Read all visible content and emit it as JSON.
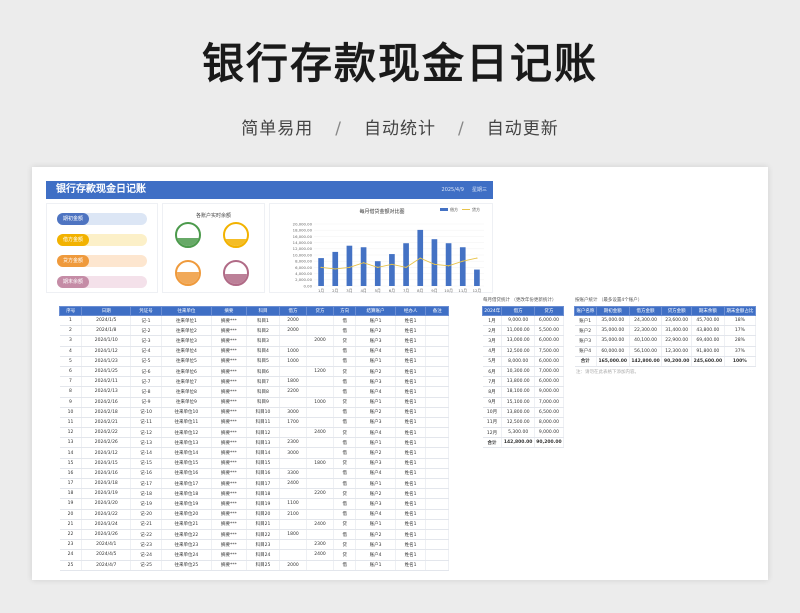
{
  "hero": {
    "title": "银行存款现金日记账",
    "subtitle": [
      "简单易用",
      "自动统计",
      "自动更新"
    ],
    "separator": "/"
  },
  "sheet": {
    "title": "银行存款现金日记账",
    "date": "2025/4/9",
    "weekday": "星期三"
  },
  "summary_pills": [
    {
      "label": "期初金额",
      "color": "#4e74c1",
      "track": "#dce6f5"
    },
    {
      "label": "借方金额",
      "color": "#f2b200",
      "track": "#fcf0c8"
    },
    {
      "label": "贷方金额",
      "color": "#ef9a3c",
      "track": "#fde6cf"
    },
    {
      "label": "期末余额",
      "color": "#c58ca6",
      "track": "#f4e1ea"
    }
  ],
  "gauges": {
    "title": "各账户实时余额",
    "items": [
      {
        "color": "#4c9a4c",
        "level": 0.35
      },
      {
        "color": "#f2b200",
        "level": 0.3
      },
      {
        "color": "#ef9a3c",
        "level": 0.55
      },
      {
        "color": "#b06a86",
        "level": 0.45
      }
    ]
  },
  "chart_data": {
    "type": "bar",
    "title": "每月借贷金额对比图",
    "legend": [
      "借方",
      "贷方"
    ],
    "legend_position": "top-right",
    "categories": [
      "1月",
      "2月",
      "3月",
      "4月",
      "5月",
      "6月",
      "7月",
      "8月",
      "9月",
      "10月",
      "11月",
      "12月"
    ],
    "y_ticks": [
      "20,000.00",
      "18,000.00",
      "16,000.00",
      "14,000.00",
      "12,000.00",
      "10,000.00",
      "8,000.00",
      "6,000.00",
      "4,000.00",
      "2,000.00",
      "0.00"
    ],
    "ylim": [
      0,
      20000
    ],
    "series": [
      {
        "name": "借方",
        "type": "bar",
        "color": "#4472c4",
        "values": [
          9000,
          11000,
          13000,
          12500,
          8000,
          10300,
          13800,
          18100,
          15100,
          13800,
          12500,
          5300
        ]
      },
      {
        "name": "贷方",
        "type": "line",
        "color": "#e8c34a",
        "values": [
          6000,
          5500,
          6000,
          7500,
          6000,
          7000,
          6000,
          9000,
          7000,
          6500,
          8000,
          9000
        ]
      }
    ]
  },
  "journal": {
    "headers": [
      "序号",
      "日期",
      "凭证号",
      "往来单位",
      "摘要",
      "科目",
      "借方",
      "贷方",
      "方向",
      "结算账户",
      "经办人",
      "备注"
    ],
    "rows": [
      [
        "1",
        "2024/1/5",
        "记-1",
        "往来单位1",
        "摘要***",
        "科目1",
        "2000",
        "",
        "借",
        "账户1",
        "姓名1",
        ""
      ],
      [
        "2",
        "2024/1/8",
        "记-2",
        "往来单位2",
        "摘要***",
        "科目2",
        "2000",
        "",
        "借",
        "账户2",
        "姓名1",
        ""
      ],
      [
        "3",
        "2024/1/10",
        "记-3",
        "往来单位3",
        "摘要***",
        "科目3",
        "",
        "2000",
        "贷",
        "账户3",
        "姓名1",
        ""
      ],
      [
        "4",
        "2024/1/12",
        "记-4",
        "往来单位4",
        "摘要***",
        "科目4",
        "1000",
        "",
        "借",
        "账户4",
        "姓名1",
        ""
      ],
      [
        "5",
        "2024/1/23",
        "记-5",
        "往来单位5",
        "摘要***",
        "科目5",
        "1000",
        "",
        "借",
        "账户1",
        "姓名1",
        ""
      ],
      [
        "6",
        "2024/1/25",
        "记-6",
        "往来单位6",
        "摘要***",
        "科目6",
        "",
        "1200",
        "贷",
        "账户2",
        "姓名1",
        ""
      ],
      [
        "7",
        "2024/2/11",
        "记-7",
        "往来单位7",
        "摘要***",
        "科目7",
        "1800",
        "",
        "借",
        "账户3",
        "姓名1",
        ""
      ],
      [
        "8",
        "2024/2/13",
        "记-8",
        "往来单位8",
        "摘要***",
        "科目8",
        "2200",
        "",
        "借",
        "账户4",
        "姓名1",
        ""
      ],
      [
        "9",
        "2024/2/16",
        "记-9",
        "往来单位9",
        "摘要***",
        "科目9",
        "",
        "1000",
        "贷",
        "账户1",
        "姓名1",
        ""
      ],
      [
        "10",
        "2024/2/18",
        "记-10",
        "往来单位10",
        "摘要***",
        "科目10",
        "3000",
        "",
        "借",
        "账户2",
        "姓名1",
        ""
      ],
      [
        "11",
        "2024/2/21",
        "记-11",
        "往来单位11",
        "摘要***",
        "科目11",
        "1700",
        "",
        "借",
        "账户3",
        "姓名1",
        ""
      ],
      [
        "12",
        "2024/2/22",
        "记-12",
        "往来单位12",
        "摘要***",
        "科目12",
        "",
        "2400",
        "贷",
        "账户4",
        "姓名1",
        ""
      ],
      [
        "13",
        "2024/2/26",
        "记-13",
        "往来单位13",
        "摘要***",
        "科目13",
        "2300",
        "",
        "借",
        "账户1",
        "姓名1",
        ""
      ],
      [
        "14",
        "2024/3/12",
        "记-14",
        "往来单位14",
        "摘要***",
        "科目14",
        "3000",
        "",
        "借",
        "账户2",
        "姓名1",
        ""
      ],
      [
        "15",
        "2024/3/15",
        "记-15",
        "往来单位15",
        "摘要***",
        "科目15",
        "",
        "1800",
        "贷",
        "账户3",
        "姓名1",
        ""
      ],
      [
        "16",
        "2024/3/16",
        "记-16",
        "往来单位16",
        "摘要***",
        "科目16",
        "3300",
        "",
        "借",
        "账户4",
        "姓名1",
        ""
      ],
      [
        "17",
        "2024/3/18",
        "记-17",
        "往来单位17",
        "摘要***",
        "科目17",
        "2400",
        "",
        "借",
        "账户1",
        "姓名1",
        ""
      ],
      [
        "18",
        "2024/3/19",
        "记-18",
        "往来单位18",
        "摘要***",
        "科目18",
        "",
        "2200",
        "贷",
        "账户2",
        "姓名1",
        ""
      ],
      [
        "19",
        "2024/3/20",
        "记-19",
        "往来单位19",
        "摘要***",
        "科目19",
        "1100",
        "",
        "借",
        "账户3",
        "姓名1",
        ""
      ],
      [
        "20",
        "2024/3/22",
        "记-20",
        "往来单位20",
        "摘要***",
        "科目20",
        "2100",
        "",
        "借",
        "账户4",
        "姓名1",
        ""
      ],
      [
        "21",
        "2024/3/24",
        "记-21",
        "往来单位21",
        "摘要***",
        "科目21",
        "",
        "2400",
        "贷",
        "账户1",
        "姓名1",
        ""
      ],
      [
        "22",
        "2024/3/26",
        "记-22",
        "往来单位22",
        "摘要***",
        "科目22",
        "1800",
        "",
        "借",
        "账户2",
        "姓名1",
        ""
      ],
      [
        "23",
        "2024/4/1",
        "记-23",
        "往来单位23",
        "摘要***",
        "科目23",
        "",
        "2300",
        "贷",
        "账户3",
        "姓名1",
        ""
      ],
      [
        "24",
        "2024/4/5",
        "记-24",
        "往来单位24",
        "摘要***",
        "科目24",
        "",
        "2400",
        "贷",
        "账户4",
        "姓名1",
        ""
      ],
      [
        "25",
        "2024/4/7",
        "记-25",
        "往来单位25",
        "摘要***",
        "科目25",
        "2000",
        "",
        "借",
        "账户1",
        "姓名1",
        ""
      ]
    ]
  },
  "monthly": {
    "caption": "每月借贷统计    （更改年份更新统计）",
    "headers": [
      "2024年",
      "借方",
      "贷方"
    ],
    "rows": [
      [
        "1月",
        "9,000.00",
        "6,000.00"
      ],
      [
        "2月",
        "11,000.00",
        "5,500.00"
      ],
      [
        "3月",
        "13,000.00",
        "6,000.00"
      ],
      [
        "4月",
        "12,500.00",
        "7,500.00"
      ],
      [
        "5月",
        "8,000.00",
        "6,000.00"
      ],
      [
        "6月",
        "10,300.00",
        "7,000.00"
      ],
      [
        "7月",
        "13,800.00",
        "6,000.00"
      ],
      [
        "8月",
        "18,100.00",
        "9,000.00"
      ],
      [
        "9月",
        "15,100.00",
        "7,000.00"
      ],
      [
        "10月",
        "13,800.00",
        "6,500.00"
      ],
      [
        "11月",
        "12,500.00",
        "8,000.00"
      ],
      [
        "12月",
        "5,300.00",
        "9,000.00"
      ]
    ],
    "total": [
      "合计",
      "142,800.00",
      "90,200.00"
    ]
  },
  "accounts": {
    "caption": "按账户统计  （最多设置4个账户）",
    "headers": [
      "账户名称",
      "期初金额",
      "借方金额",
      "贷方金额",
      "期末余额",
      "期末金额占比"
    ],
    "rows": [
      [
        "账户1",
        "35,000.00",
        "24,300.00",
        "23,600.00",
        "45,700.00",
        "18%"
      ],
      [
        "账户2",
        "35,000.00",
        "22,300.00",
        "31,400.00",
        "43,800.00",
        "17%"
      ],
      [
        "账户3",
        "35,000.00",
        "40,100.00",
        "22,900.00",
        "69,400.00",
        "28%"
      ],
      [
        "账户4",
        "60,000.00",
        "56,100.00",
        "12,300.00",
        "91,800.00",
        "37%"
      ]
    ],
    "total": [
      "合计",
      "165,000.00",
      "142,800.00",
      "90,200.00",
      "245,600.00",
      "100%"
    ],
    "note": "注：请勿在此表格下添加内容。"
  }
}
